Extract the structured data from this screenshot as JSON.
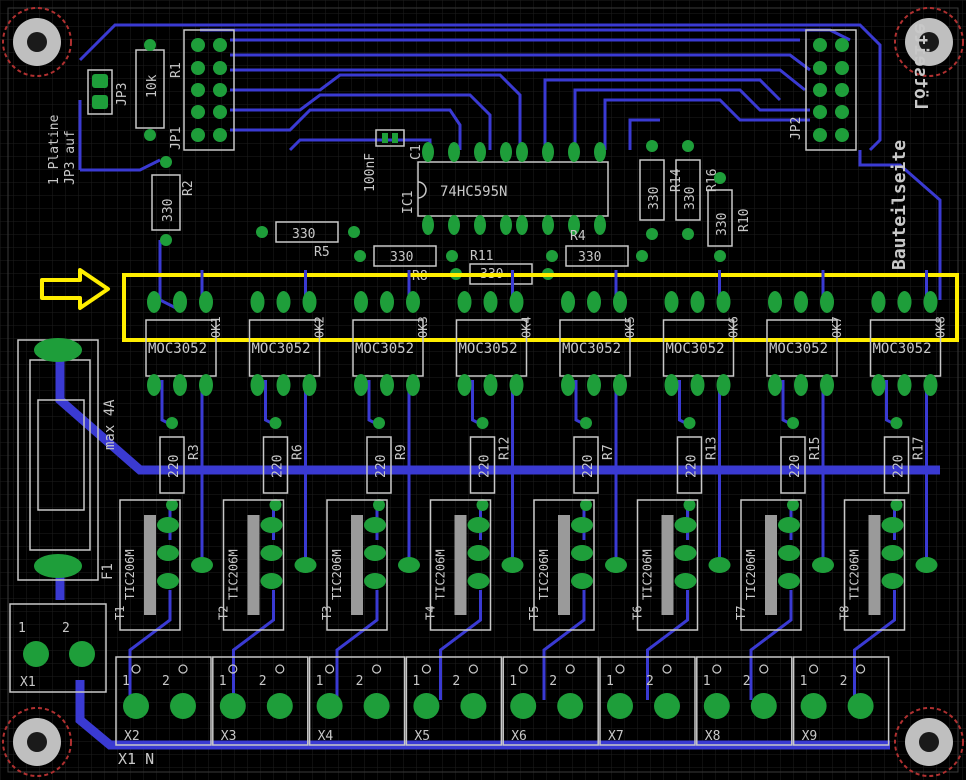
{
  "colors": {
    "background": "#000000",
    "grid": "#1e1e1e",
    "trace": "#3a3ad2",
    "pad": "#1e9e3a",
    "pad_hole": "#0c4a18",
    "silk": "#c8c8c8",
    "highlight": "#ffee00",
    "mount_ring": "#b03030"
  },
  "labels": {
    "jp3": "JP3",
    "r1": "R1",
    "r1_value": "10k",
    "jp1": "JP1",
    "note_line1": "1 Platine",
    "note_line2": "JP3 auf",
    "c1": "C1",
    "c1_value": "100nF",
    "ic1": "IC1",
    "ic1_value": "74HC595N",
    "r2": "R2",
    "r2_value": "330",
    "r5": "R5",
    "r5_value": "330",
    "r8": "R8",
    "r8_value": "330",
    "r11": "R11",
    "r11_value": "330",
    "r4": "R4",
    "r4_value": "330",
    "r14": "R14",
    "r14_value": "330",
    "r16": "R16",
    "r16_value": "330",
    "r10": "R10",
    "r10_value": "330",
    "jp2": "JP2",
    "side_label": "Bauteilseite",
    "side_label_mirror": "Lötseite",
    "fuse_rating": "max 4A",
    "fuse_name": "F1",
    "x1": "X1",
    "bottom_left": "X1   N"
  },
  "optocouplers": [
    {
      "name": "OK1",
      "part": "MOC3052"
    },
    {
      "name": "OK2",
      "part": "MOC3052"
    },
    {
      "name": "OK3",
      "part": "MOC3052"
    },
    {
      "name": "OK4",
      "part": "MOC3052"
    },
    {
      "name": "OK5",
      "part": "MOC3052"
    },
    {
      "name": "OK6",
      "part": "MOC3052"
    },
    {
      "name": "OK7",
      "part": "MOC3052"
    },
    {
      "name": "OK8",
      "part": "MOC3052"
    }
  ],
  "gate_resistors": [
    {
      "name": "R3",
      "value": "220"
    },
    {
      "name": "R6",
      "value": "220"
    },
    {
      "name": "R9",
      "value": "220"
    },
    {
      "name": "R12",
      "value": "220"
    },
    {
      "name": "R7",
      "value": "220"
    },
    {
      "name": "R13",
      "value": "220"
    },
    {
      "name": "R15",
      "value": "220"
    },
    {
      "name": "R17",
      "value": "220"
    }
  ],
  "triacs": [
    {
      "name": "T1",
      "part": "TIC206M"
    },
    {
      "name": "T2",
      "part": "TIC206M"
    },
    {
      "name": "T3",
      "part": "TIC206M"
    },
    {
      "name": "T4",
      "part": "TIC206M"
    },
    {
      "name": "T5",
      "part": "TIC206M"
    },
    {
      "name": "T6",
      "part": "TIC206M"
    },
    {
      "name": "T7",
      "part": "TIC206M"
    },
    {
      "name": "T8",
      "part": "TIC206M"
    }
  ],
  "terminals": [
    {
      "name": "X2"
    },
    {
      "name": "X3"
    },
    {
      "name": "X4"
    },
    {
      "name": "X5"
    },
    {
      "name": "X6"
    },
    {
      "name": "X7"
    },
    {
      "name": "X8"
    },
    {
      "name": "X9"
    }
  ],
  "pin_labels": {
    "one": "1",
    "two": "2"
  }
}
